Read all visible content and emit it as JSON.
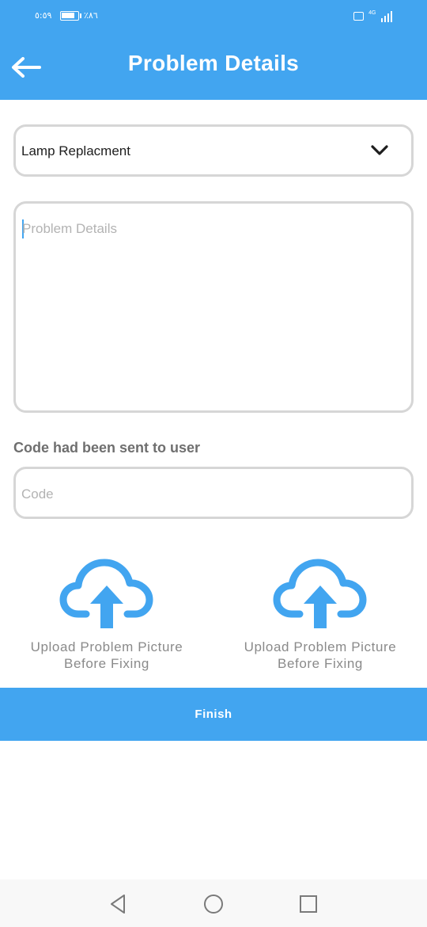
{
  "status_bar": {
    "time": "٥:٥٩",
    "battery_percent": "٪٨٦",
    "battery_level": 0.86,
    "network": "4G"
  },
  "header": {
    "title": "Problem Details",
    "back_icon": "arrow-left-icon"
  },
  "form": {
    "problem_type": {
      "selected": "Lamp Replacment",
      "icon": "chevron-down-icon"
    },
    "details": {
      "placeholder": "Problem Details",
      "value": ""
    },
    "code": {
      "label": "Code had been sent to user",
      "placeholder": "Code",
      "value": ""
    }
  },
  "uploads": [
    {
      "label_line1": "Upload Problem Picture",
      "label_line2": "Before Fixing",
      "icon": "cloud-upload-icon"
    },
    {
      "label_line1": "Upload Problem Picture",
      "label_line2": "Before Fixing",
      "icon": "cloud-upload-icon"
    }
  ],
  "actions": {
    "finish_label": "Finish"
  },
  "colors": {
    "primary": "#42a5f0",
    "border": "#d6d6d6",
    "placeholder": "#b3b3b3",
    "label": "#6f6f6f"
  },
  "system_nav": {
    "icons": [
      "back-triangle-icon",
      "home-circle-icon",
      "recents-square-icon"
    ]
  }
}
